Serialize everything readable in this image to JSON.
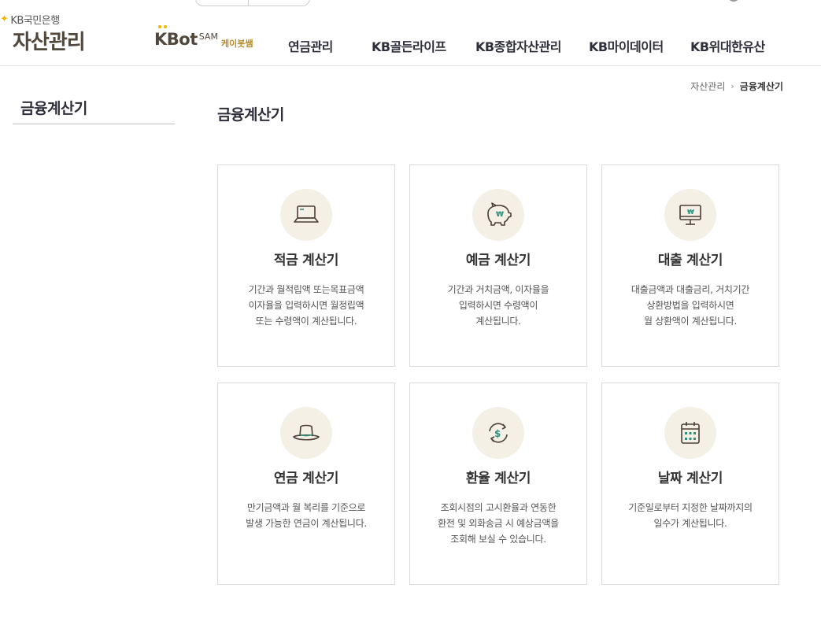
{
  "header": {
    "logo_small": "KB국민은행",
    "logo_big": "자산관리",
    "kbot_word": "KBot",
    "kbot_sam": "SAM",
    "kbot_kor": "케이봇쌤",
    "nav": [
      "연금관리",
      "KB골든라이프",
      "KB종합자산관리",
      "KB마이데이터",
      "KB위대한유산"
    ]
  },
  "breadcrumb": {
    "home": "자산관리",
    "separator": "›",
    "current": "금융계산기"
  },
  "sidebar": {
    "title": "금융계산기"
  },
  "main": {
    "title": "금융계산기",
    "cards": [
      {
        "icon": "laptop-icon",
        "title": "적금 계산기",
        "desc": [
          "기간과 월적립액 또는목표금액",
          "이자율을 입력하시면 월정립액",
          "또는 수령액이 계산됩니다."
        ]
      },
      {
        "icon": "piggy-bank-icon",
        "title": "예금 계산기",
        "desc": [
          "기간과 거치금액, 이자율을",
          "입력하시면 수령액이",
          "계산됩니다."
        ]
      },
      {
        "icon": "monitor-won-icon",
        "title": "대출 계산기",
        "desc": [
          "대출금액과 대출금리, 거치기간",
          "상환방법을 입력하시면",
          "월 상환액이 계산됩니다."
        ]
      },
      {
        "icon": "hat-icon",
        "title": "연금 계산기",
        "desc": [
          "만기금액과 월 복리를 기준으로",
          "발생 가능한 연금이 계산됩니다."
        ]
      },
      {
        "icon": "currency-exchange-icon",
        "title": "환율 계산기",
        "desc": [
          "조회시점의 고시환율과 연동한",
          "환전 및 외화송금 시 예상금액을",
          "조회해 보실 수 있습니다."
        ]
      },
      {
        "icon": "calendar-icon",
        "title": "날짜 계산기",
        "desc": [
          "기준일로부터 지정한 날짜까지의",
          "일수가 계산됩니다."
        ]
      }
    ]
  },
  "colors": {
    "brand_gold": "#f0b400",
    "brand_brown": "#52473c",
    "icon_bg": "#f4f0e6",
    "icon_accent": "#2f8f7f"
  }
}
